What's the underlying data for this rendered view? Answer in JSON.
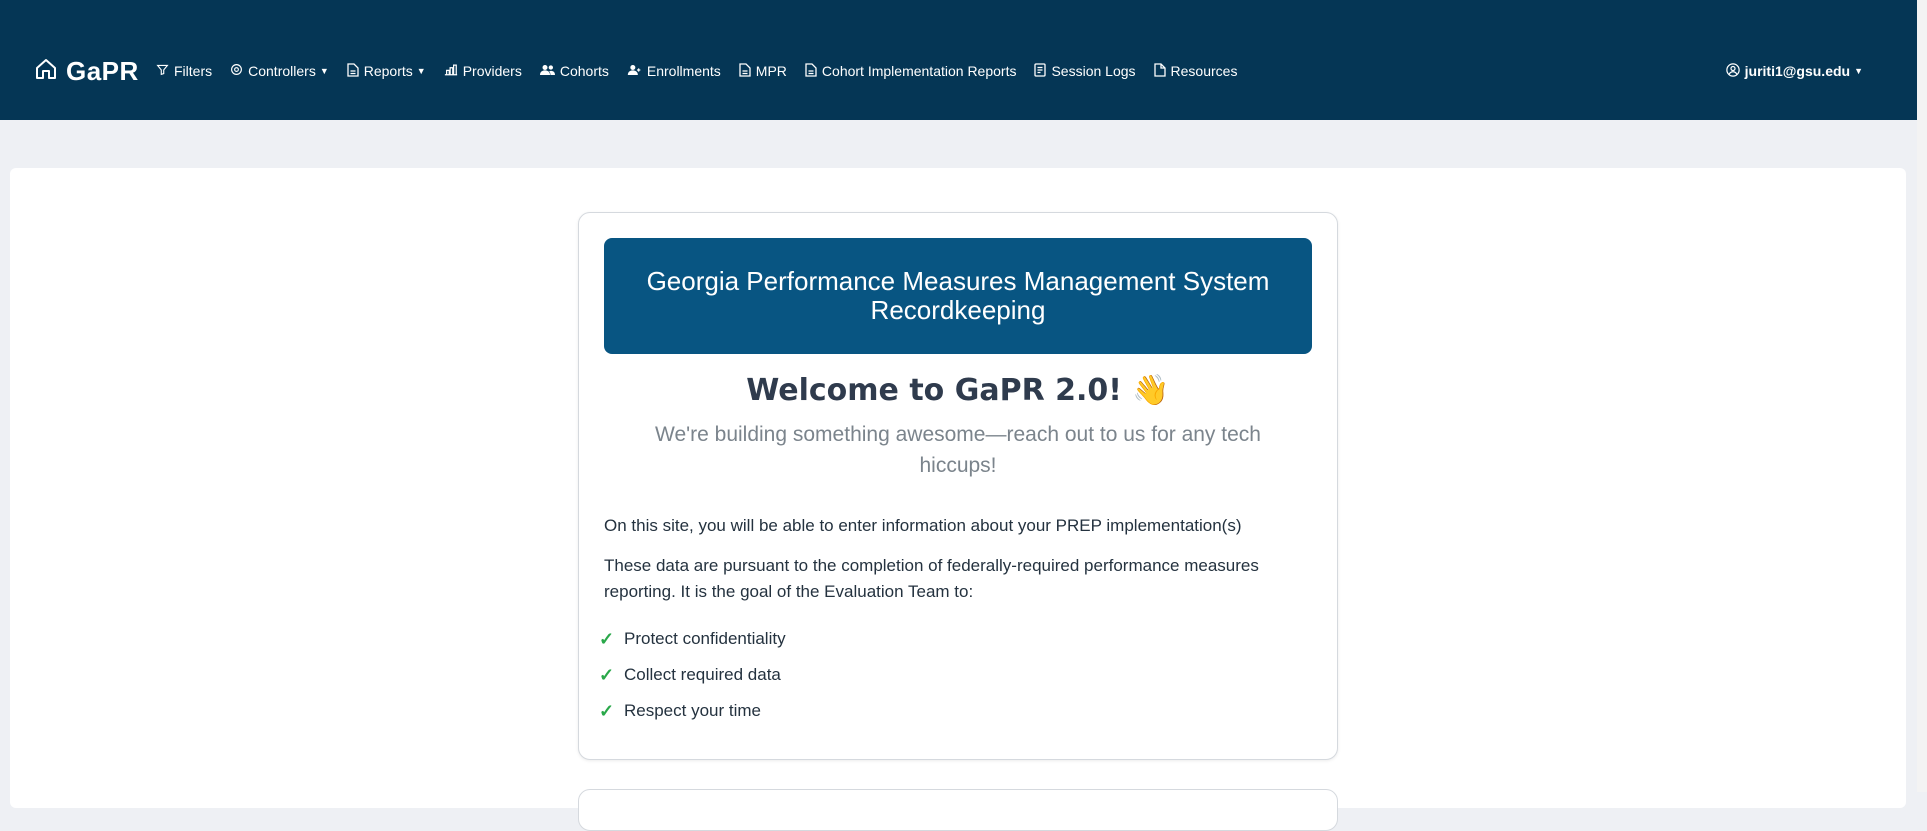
{
  "brand": {
    "name": "GaPR",
    "icon": "home-icon"
  },
  "nav": [
    {
      "key": "filters",
      "label": "Filters",
      "icon": "filter-icon",
      "dropdown": false
    },
    {
      "key": "controllers",
      "label": "Controllers",
      "icon": "gear-icon",
      "dropdown": true
    },
    {
      "key": "reports",
      "label": "Reports",
      "icon": "document-icon",
      "dropdown": true
    },
    {
      "key": "providers",
      "label": "Providers",
      "icon": "bar-chart-icon",
      "dropdown": false
    },
    {
      "key": "cohorts",
      "label": "Cohorts",
      "icon": "people-icon",
      "dropdown": false
    },
    {
      "key": "enrollments",
      "label": "Enrollments",
      "icon": "person-add-icon",
      "dropdown": false
    },
    {
      "key": "mpr",
      "label": "MPR",
      "icon": "document-icon",
      "dropdown": false
    },
    {
      "key": "cohort-implementation-reports",
      "label": "Cohort Implementation Reports",
      "icon": "document-icon",
      "dropdown": false
    },
    {
      "key": "session-logs",
      "label": "Session Logs",
      "icon": "log-icon",
      "dropdown": false
    },
    {
      "key": "resources",
      "label": "Resources",
      "icon": "file-icon",
      "dropdown": false
    }
  ],
  "user": {
    "email": "juriti1@gsu.edu",
    "icon": "user-circle-icon"
  },
  "card": {
    "hero_title": "Georgia Performance Measures Management System Recordkeeping",
    "welcome": "Welcome to GaPR 2.0!",
    "welcome_emoji": "👋",
    "subtitle": "We're building something awesome—reach out to us for any tech hiccups!",
    "paragraph1": "On this site, you will be able to enter information about your PREP implementation(s)",
    "paragraph2": "These data are pursuant to the completion of federally-required performance measures reporting. It is the goal of the Evaluation Team to:",
    "goals": [
      "Protect confidentiality",
      "Collect required data",
      "Respect your time"
    ],
    "check_glyph": "✓"
  },
  "colors": {
    "navbar": "#053655",
    "hero": "#085582",
    "check": "#2aa84a"
  }
}
